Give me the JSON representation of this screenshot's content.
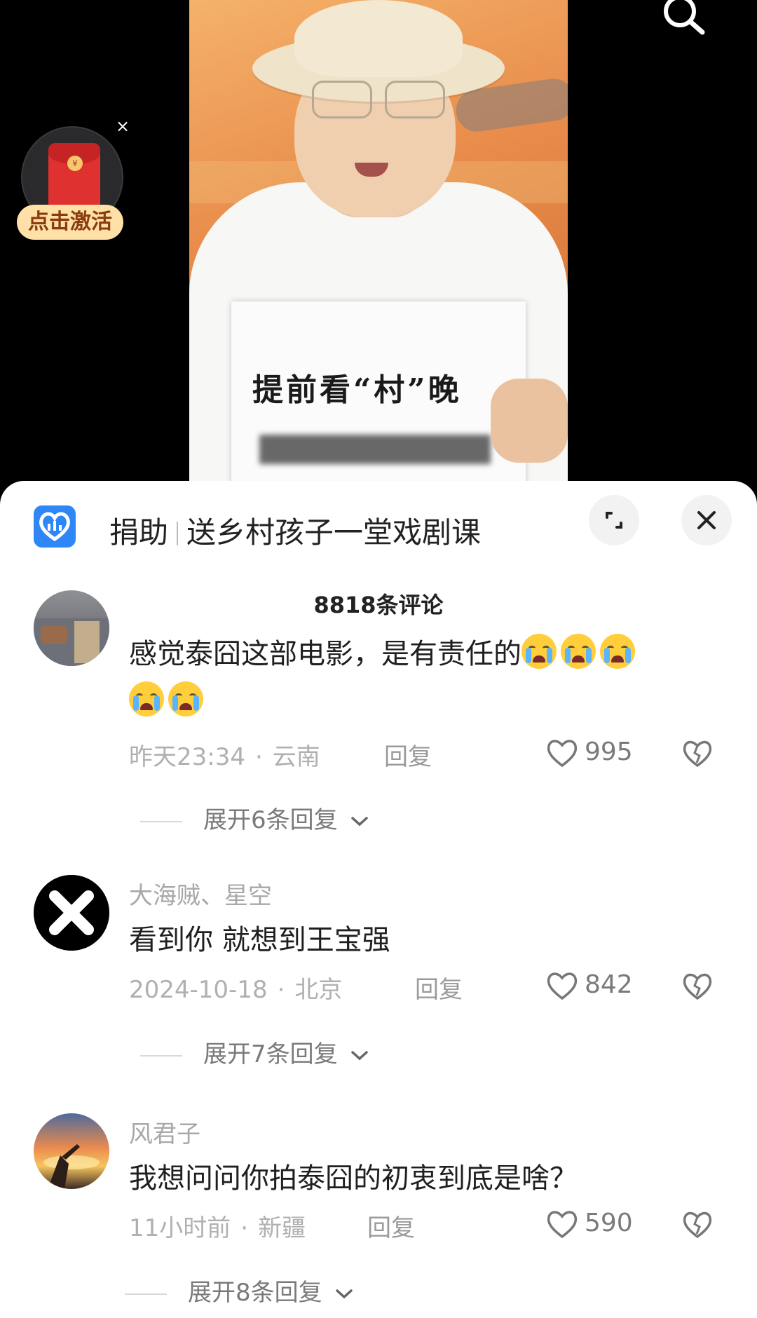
{
  "video": {
    "sign_text": "提前看“村”晚"
  },
  "overlay": {
    "search_icon": "search-icon",
    "red_packet_label": "点击激活",
    "red_packet_close": "×"
  },
  "banner": {
    "prefix": "捐助",
    "title": "送乡村孩子一堂戏剧课",
    "expand_icon": "expand-icon",
    "close_icon": "close-icon"
  },
  "comments_header": {
    "count_label": "8818条评论"
  },
  "comments": [
    {
      "username": "",
      "text": "感觉泰囧这部电影，是有责任的",
      "emoji_count_line1": 3,
      "emoji_count_line2": 2,
      "time": "昨天23:34",
      "location": "云南",
      "reply_label": "回复",
      "likes": "995",
      "expand_label": "展开6条回复"
    },
    {
      "username": "大海贼、星空",
      "text": "看到你 就想到王宝强",
      "time": "2024-10-18",
      "location": "北京",
      "reply_label": "回复",
      "likes": "842",
      "expand_label": "展开7条回复"
    },
    {
      "username": "风君子",
      "text": "我想问问你拍泰囧的初衷到底是啥？",
      "time": "11小时前",
      "location": "新疆",
      "reply_label": "回复",
      "likes": "590",
      "expand_label": "展开8条回复"
    }
  ]
}
